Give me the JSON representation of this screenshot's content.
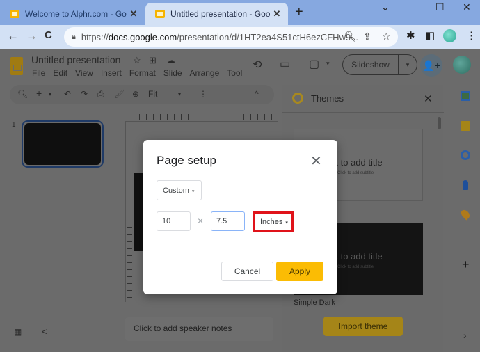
{
  "browser": {
    "tabs": [
      {
        "title": "Welcome to Alphr.com - Google",
        "active": false
      },
      {
        "title": "Untitled presentation - Google Sl",
        "active": true
      }
    ],
    "new_tab": "+",
    "window_controls": {
      "tab_search": "⌄",
      "minimize": "–",
      "maximize": "☐",
      "close": "✕"
    },
    "nav": {
      "back": "←",
      "forward": "→",
      "reload": "C"
    },
    "url": {
      "scheme": "https://",
      "host": "docs.google.com",
      "path": "/presentation/d/1HT2ea4S51ctH6ezCFHw9..."
    },
    "omnibox_icons": {
      "zoom": "🔍︎",
      "share": "⇪",
      "star": "☆"
    },
    "extension_icons": {
      "puzzle": "✱",
      "sidepanel": "◧",
      "menu": "⋮"
    }
  },
  "app": {
    "title": "Untitled presentation",
    "title_icons": {
      "star": "☆",
      "move": "⊞",
      "cloud": "☁"
    },
    "menu": [
      "File",
      "Edit",
      "View",
      "Insert",
      "Format",
      "Slide",
      "Arrange",
      "Tool"
    ],
    "header_icons": {
      "history": "⟲",
      "comments": "▭",
      "meet": "▢",
      "meet_caret": "▾"
    },
    "slideshow_label": "Slideshow",
    "slideshow_caret": "▾",
    "share_icon": "👤+",
    "toolbar": {
      "search": "🔍︎",
      "add": "+",
      "add_caret": "▾",
      "undo": "↶",
      "redo": "↷",
      "print": "⎙",
      "paint_format": "🖌",
      "zoom_icon": "⊕",
      "zoom_value": "Fit",
      "zoom_caret": "▾",
      "more": "⋮",
      "collapse": "^"
    },
    "filmstrip": {
      "slide_number": "1"
    },
    "speaker_notes_placeholder": "Click to add speaker notes",
    "grid_view_icon": "▦",
    "collapse_panel_icon": "<"
  },
  "themes_panel": {
    "title": "Themes",
    "close": "✕",
    "themes": [
      {
        "name": "",
        "title_placeholder": "ck to add title",
        "subtitle_placeholder": "Click to add subtitle",
        "style": "light"
      },
      {
        "name": "Simple Dark",
        "title_placeholder": "ck to add title",
        "subtitle_placeholder": "Click to add subtitle",
        "style": "dark"
      }
    ],
    "import_button": "Import theme"
  },
  "side_rail": {
    "icons": [
      "calendar-icon",
      "keep-icon",
      "tasks-icon",
      "contacts-icon",
      "maps-icon"
    ],
    "add": "+",
    "expand": "›"
  },
  "dialog": {
    "title": "Page setup",
    "close": "✕",
    "preset": "Custom",
    "width_value": "10",
    "times": "×",
    "height_value": "7.5",
    "unit": "Inches",
    "caret": "▾",
    "cancel_label": "Cancel",
    "apply_label": "Apply",
    "colors": {
      "apply": "#fbbc04",
      "highlight": "#e0131a",
      "focus": "#8ab4f8"
    }
  }
}
